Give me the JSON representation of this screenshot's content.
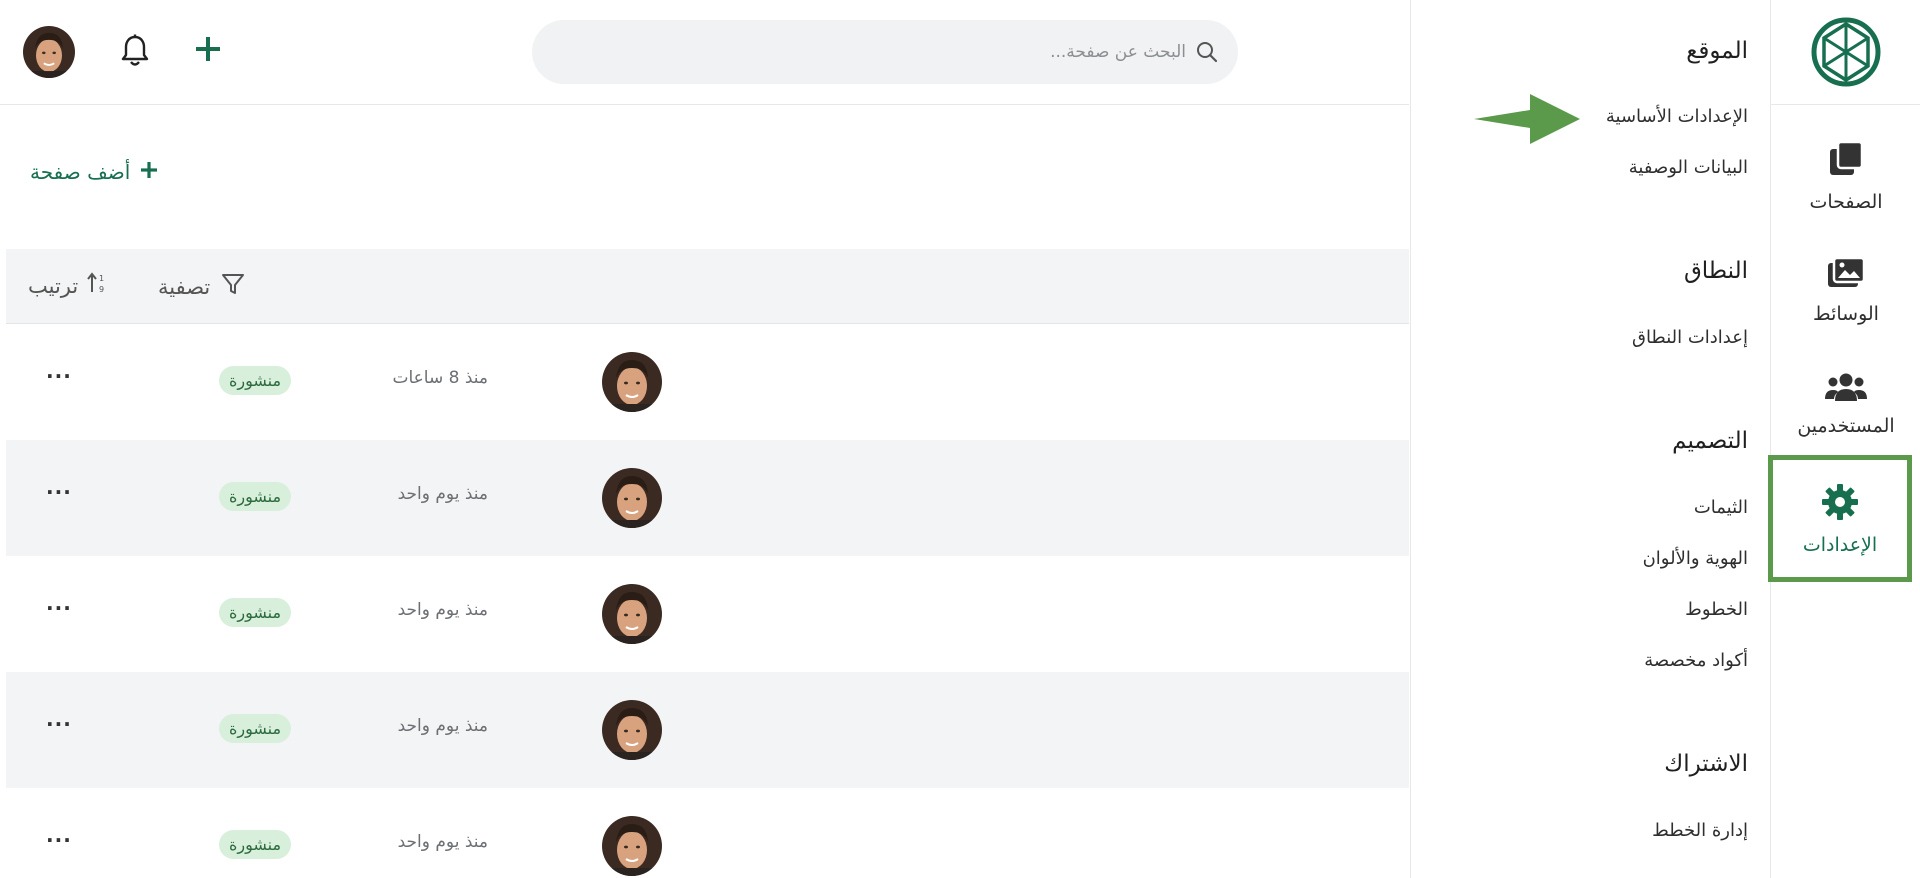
{
  "colors": {
    "brand": "#176f4f",
    "active_border": "#5b9a4a",
    "arrow": "#5b9a4a",
    "badge_bg": "#d8efdc"
  },
  "rail": {
    "logo_icon": "leaf-globe-logo",
    "items": [
      {
        "label": "الصفحات",
        "icon": "pages-icon"
      },
      {
        "label": "الوسائط",
        "icon": "media-icon"
      },
      {
        "label": "المستخدمين",
        "icon": "users-icon"
      },
      {
        "label": "الإعدادات",
        "icon": "gear-icon",
        "active": true
      }
    ]
  },
  "subnav": {
    "site": {
      "title": "الموقع",
      "links": [
        "الإعدادات الأساسية",
        "البيانات الوصفية"
      ]
    },
    "domain": {
      "title": "النطاق",
      "links": [
        "إعدادات النطاق"
      ]
    },
    "design": {
      "title": "التصميم",
      "links": [
        "الثيمات",
        "الهوية والألوان",
        "الخطوط",
        "أكواد مخصصة"
      ]
    },
    "subscription": {
      "title": "الاشتراك",
      "links": [
        "إدارة الخطط"
      ]
    }
  },
  "topbar": {
    "search_placeholder": "البحث عن صفحة..."
  },
  "content": {
    "add_page_label": "أضف صفحة",
    "filter_label": "تصفية",
    "sort_label": "ترتيب"
  },
  "pages": [
    {
      "time": "منذ 8 ساعات",
      "status": "منشورة"
    },
    {
      "time": "منذ يوم واحد",
      "status": "منشورة"
    },
    {
      "time": "منذ يوم واحد",
      "status": "منشورة"
    },
    {
      "time": "منذ يوم واحد",
      "status": "منشورة"
    },
    {
      "time": "منذ يوم واحد",
      "status": "منشورة"
    }
  ]
}
